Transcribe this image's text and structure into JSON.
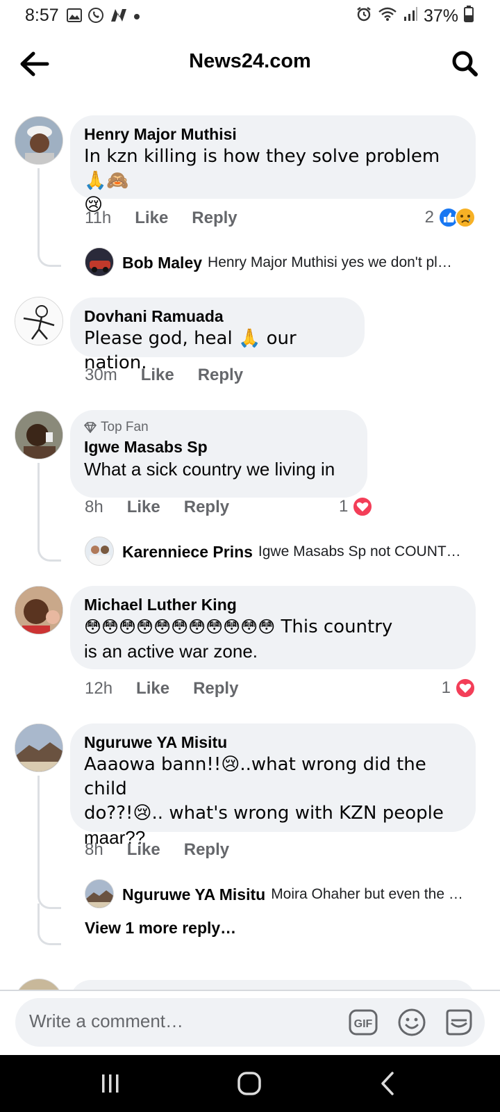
{
  "status_bar": {
    "time": "8:57",
    "battery": "37%"
  },
  "header": {
    "title": "News24.com"
  },
  "comments": [
    {
      "author": "Henry Major Muthisi",
      "text": "In kzn killing is how they solve problem🙏🙈",
      "text2": "😢",
      "time": "11h",
      "like": "Like",
      "reply": "Reply",
      "reaction_count": "2",
      "replies": [
        {
          "name": "Bob Maley",
          "text": "Henry Major Muthisi yes we don't pl…"
        }
      ]
    },
    {
      "author": "Dovhani Ramuada",
      "text": "Please god, heal 🙏 our nation.",
      "time": "30m",
      "like": "Like",
      "reply": "Reply"
    },
    {
      "badge": "Top Fan",
      "author": "Igwe Masabs Sp",
      "text": "What a sick country we living in",
      "time": "8h",
      "like": "Like",
      "reply": "Reply",
      "reaction_count": "1",
      "replies": [
        {
          "name": "Karenniece Prins",
          "text": "Igwe Masabs Sp not COUNT…"
        }
      ]
    },
    {
      "author": "Michael Luther King",
      "text_emoji": "😳😳😳😳😳😳😳😳😳😳😳",
      "text": " This country",
      "text2": "is an active war zone.",
      "time": "12h",
      "like": "Like",
      "reply": "Reply",
      "reaction_count": "1"
    },
    {
      "author": "Nguruwe YA Misitu",
      "text": "Aaaowa bann!!😢..what wrong did the child",
      "text2": "do??!😢.. what's wrong with KZN people",
      "text3": "maar??",
      "time": "8h",
      "like": "Like",
      "reply": "Reply",
      "replies": [
        {
          "name": "Nguruwe YA Misitu",
          "text": "Moira Ohaher but even the …"
        }
      ],
      "view_more": "View 1 more reply…"
    }
  ],
  "composer": {
    "placeholder": "Write a comment…",
    "gif_label": "GIF"
  },
  "colors": {
    "like_blue": "#1877f2",
    "love_red": "#f33e58",
    "bubble_bg": "#f0f2f5",
    "meta_gray": "#65676b"
  }
}
